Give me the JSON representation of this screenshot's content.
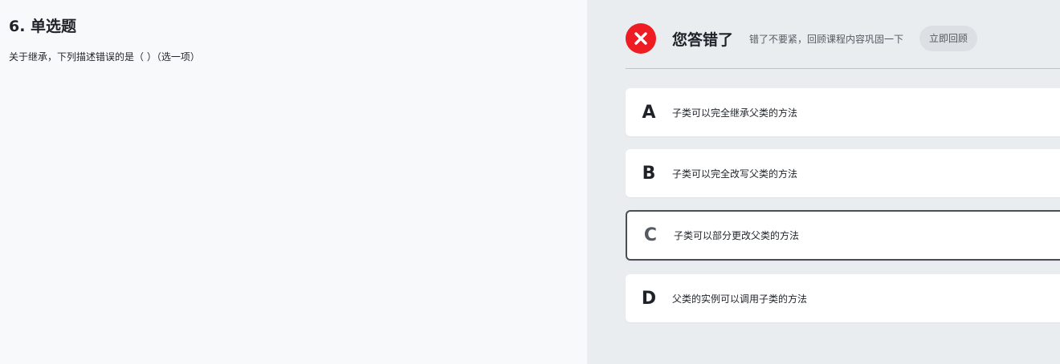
{
  "question": {
    "title": "6. 单选题",
    "text": "关于继承，下列描述错误的是（ ）（选一项）"
  },
  "result": {
    "icon": "error-x-icon",
    "title": "您答错了",
    "hint": "错了不要紧，回顾课程内容巩固一下",
    "review_label": "立即回顾",
    "status_color": "#ee1d23"
  },
  "options": [
    {
      "letter": "A",
      "text": "子类可以完全继承父类的方法",
      "selected": false
    },
    {
      "letter": "B",
      "text": "子类可以完全改写父类的方法",
      "selected": false
    },
    {
      "letter": "C",
      "text": "子类可以部分更改父类的方法",
      "selected": true
    },
    {
      "letter": "D",
      "text": "父类的实例可以调用子类的方法",
      "selected": false
    }
  ]
}
